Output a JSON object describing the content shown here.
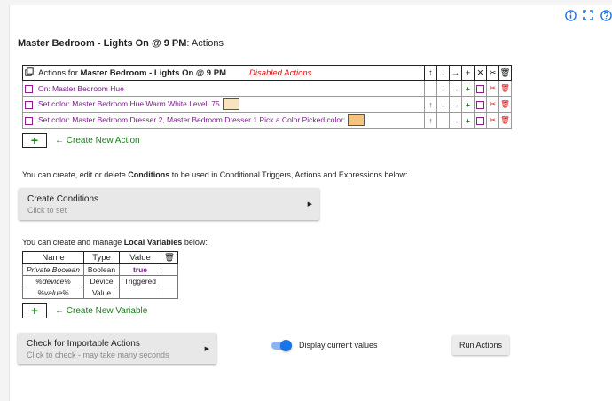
{
  "page": {
    "title_bold": "Master Bedroom - Lights On @ 9 PM",
    "title_suffix": ": Actions"
  },
  "actions_table": {
    "header_prefix": "Actions for ",
    "header_name": "Master Bedroom - Lights On @ 9 PM",
    "disabled_label": "Disabled Actions",
    "header_controls": [
      "↑",
      "↓",
      "→",
      "+",
      "✕",
      "✂",
      "🗑"
    ],
    "rows": [
      {
        "text": "On: Master Bedroom Hue",
        "swatch": null,
        "has_up": false,
        "has_down": true
      },
      {
        "text": "Set color: Master Bedroom Hue  Warm White  Level: 75",
        "swatch": "#f7e3c0",
        "has_up": true,
        "has_down": true
      },
      {
        "text": "Set color: Master Bedroom Dresser 2, Master Bedroom Dresser 1  Pick a Color  Picked color:",
        "swatch": "#f6c37e",
        "has_up": true,
        "has_down": false
      }
    ],
    "add_label": "Create New Action"
  },
  "conditions": {
    "intro_prefix": "You can create, edit or delete ",
    "intro_bold": "Conditions",
    "intro_suffix": " to be used in Conditional Triggers, Actions and Expressions below:",
    "button_label": "Create Conditions",
    "button_sub": "Click to set"
  },
  "variables": {
    "intro_prefix": "You can create and manage ",
    "intro_bold": "Local Variables",
    "intro_suffix": " below:",
    "headers": [
      "Name",
      "Type",
      "Value"
    ],
    "rows": [
      {
        "name": "Private Boolean",
        "type": "Boolean",
        "value": "true"
      },
      {
        "name": "%device%",
        "type": "Device",
        "value": "Triggered"
      },
      {
        "name": "%value%",
        "type": "Value",
        "value": ""
      }
    ],
    "add_label": "Create New Variable"
  },
  "importable": {
    "button_label": "Check for Importable Actions",
    "button_sub": "Click to check - may take many seconds"
  },
  "display_toggle": {
    "label": "Display current values",
    "on": true
  },
  "run_button": {
    "label": "Run Actions"
  },
  "colors": {
    "accent": "#1a73e8",
    "purple": "#7a1d8a",
    "green": "#1b7d1b",
    "red": "#d11111"
  }
}
